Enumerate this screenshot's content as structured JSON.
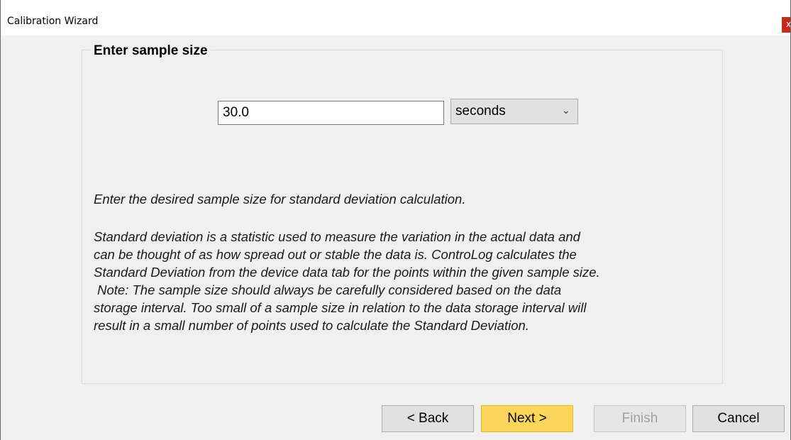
{
  "window": {
    "title": "Calibration Wizard",
    "close_glyph": "x"
  },
  "group": {
    "legend": "Enter sample size"
  },
  "sample": {
    "value": "30.0",
    "unit_selected": "seconds"
  },
  "description": {
    "line1": "Enter the desired sample size for standard deviation calculation.",
    "paragraph2": [
      "Standard deviation is a statistic used to measure the variation in the actual data and",
      "can be thought of as how spread out or stable the data is.  ControLog calculates the",
      "Standard Deviation from the device data tab for the points within the given sample size.",
      " Note: The sample size should always be carefully considered based on the data",
      "storage interval.  Too small of a sample size in relation to the data storage interval will",
      "result in a small number of points used to calculate the Standard Deviation."
    ]
  },
  "buttons": {
    "back": "< Back",
    "next": "Next >",
    "finish": "Finish",
    "cancel": "Cancel"
  },
  "icons": {
    "dropdown": "chevron-down-icon",
    "close": "close-icon"
  },
  "colors": {
    "close_bg": "#c42b1c",
    "next_bg": "#fbd65a"
  }
}
